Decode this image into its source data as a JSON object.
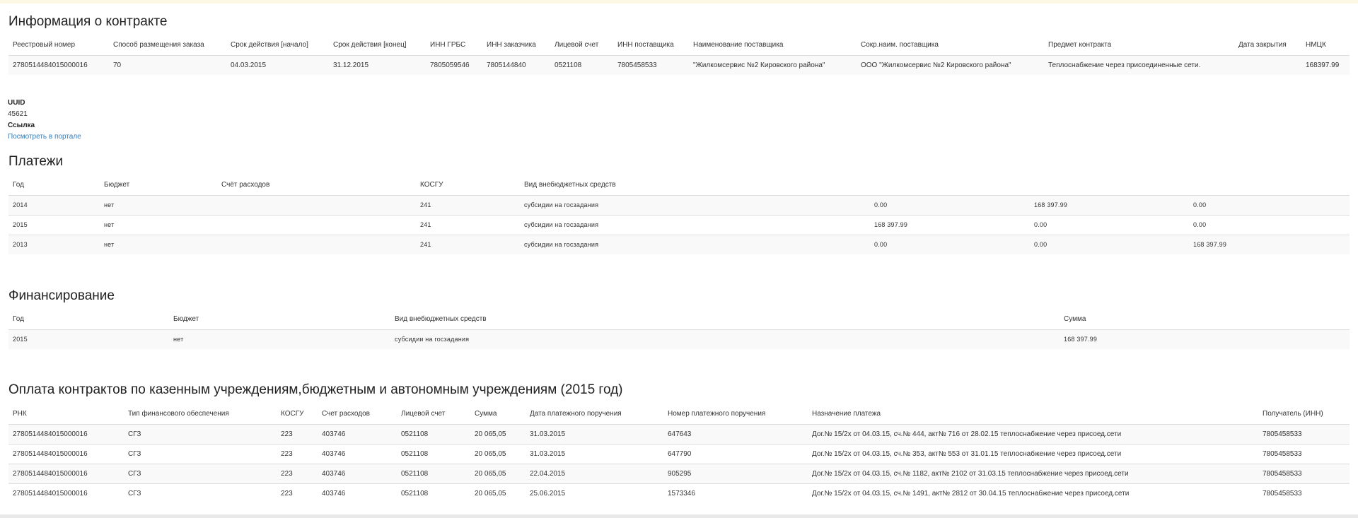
{
  "contract": {
    "title": "Информация о контракте",
    "columns": [
      "Реестровый номер",
      "Способ размещения заказа",
      "Срок действия [начало]",
      "Срок действия [конец]",
      "ИНН ГРБС",
      "ИНН заказчика",
      "Лицевой счет",
      "ИНН поставщика",
      "Наименование поставщика",
      "Сокр.наим. поставщика",
      "Предмет контракта",
      "Дата закрытия",
      "НМЦК"
    ],
    "row": [
      "2780514484015000016",
      "70",
      "04.03.2015",
      "31.12.2015",
      "7805059546",
      "7805144840",
      "0521108",
      "7805458533",
      "\"Жилкомсервис №2 Кировского района\"",
      "ООО \"Жилкомсервис №2 Кировского района\"",
      "Теплоснабжение через присоединенные сети.",
      "",
      "168397.99"
    ]
  },
  "meta": {
    "uuid_label": "UUID",
    "uuid_value": "45621",
    "link_label": "Ссылка",
    "link_text": "Посмотреть в портале"
  },
  "payments": {
    "title": "Платежи",
    "columns": [
      "Год",
      "Бюджет",
      "Счёт расходов",
      "КОСГУ",
      "Вид внебюджетных средств",
      "",
      "",
      ""
    ],
    "rows": [
      [
        "2014",
        "нет",
        "",
        "241",
        "субсидии на госзадания",
        "0.00",
        "168 397.99",
        "0.00"
      ],
      [
        "2015",
        "нет",
        "",
        "241",
        "субсидии на госзадания",
        "168 397.99",
        "0.00",
        "0.00"
      ],
      [
        "2013",
        "нет",
        "",
        "241",
        "субсидии на госзадания",
        "0.00",
        "0.00",
        "168 397.99"
      ]
    ]
  },
  "financing": {
    "title": "Финансирование",
    "columns": [
      "Год",
      "Бюджет",
      "Вид внебюджетных средств",
      "Сумма"
    ],
    "rows": [
      [
        "2015",
        "нет",
        "субсидии на госзадания",
        "168 397.99"
      ]
    ]
  },
  "contract_payments": {
    "title": "Оплата контрактов по казенным учреждениям,бюджетным и автономным учреждениям (2015 год)",
    "columns": [
      "РНК",
      "Тип финансового обеспечения",
      "КОСГУ",
      "Счет расходов",
      "Лицевой счет",
      "Сумма",
      "Дата платежного поручения",
      "Номер платежного поручения",
      "Назначение платежа",
      "Получатель (ИНН)"
    ],
    "rows": [
      [
        "2780514484015000016",
        "СГЗ",
        "223",
        "403746",
        "0521108",
        "20 065,05",
        "31.03.2015",
        "647643",
        "Дог.№ 15/2х от 04.03.15, сч.№ 444, акт№ 716 от 28.02.15 теплоснабжение через присоед.сети",
        "7805458533"
      ],
      [
        "2780514484015000016",
        "СГЗ",
        "223",
        "403746",
        "0521108",
        "20 065,05",
        "31.03.2015",
        "647790",
        "Дог.№ 15/2х от 04.03.15, сч.№ 353, акт№ 553 от 31.01.15 теплоснабжение через присоед.сети",
        "7805458533"
      ],
      [
        "2780514484015000016",
        "СГЗ",
        "223",
        "403746",
        "0521108",
        "20 065,05",
        "22.04.2015",
        "905295",
        "Дог.№ 15/2х от 04.03.15, сч.№ 1182, акт№ 2102 от 31.03.15 теплоснабжение через присоед.сети",
        "7805458533"
      ],
      [
        "2780514484015000016",
        "СГЗ",
        "223",
        "403746",
        "0521108",
        "20 065,05",
        "25.06.2015",
        "1573346",
        "Дог.№ 15/2х от 04.03.15, сч.№ 1491, акт№ 2812 от 30.04.15 теплоснабжение через присоед.сети",
        "7805458533"
      ]
    ]
  }
}
